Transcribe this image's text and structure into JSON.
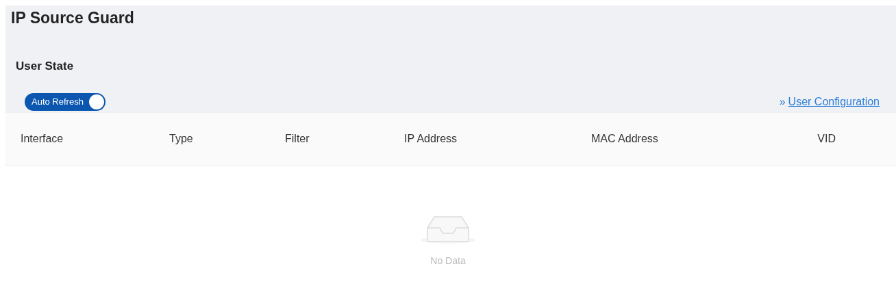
{
  "page": {
    "title": "IP Source Guard"
  },
  "section": {
    "title": "User State"
  },
  "auto_refresh": {
    "label": "Auto Refresh",
    "on": true
  },
  "link": {
    "icon": "»",
    "label": "User Configuration"
  },
  "table": {
    "columns": [
      "Interface",
      "Type",
      "Filter",
      "IP Address",
      "MAC Address",
      "VID"
    ],
    "empty_text": "No Data"
  }
}
